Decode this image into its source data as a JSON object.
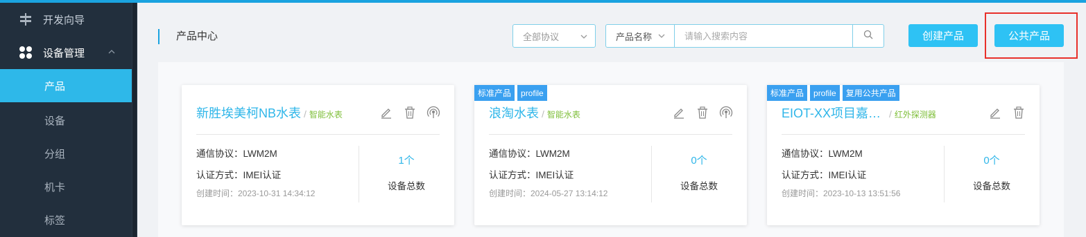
{
  "sidebar": {
    "items": [
      {
        "label": "开发向导",
        "icon": "signpost-icon"
      },
      {
        "label": "设备管理",
        "icon": "grid-icon"
      },
      {
        "label": "产品"
      },
      {
        "label": "设备"
      },
      {
        "label": "分组"
      },
      {
        "label": "机卡"
      },
      {
        "label": "标签"
      }
    ]
  },
  "header": {
    "title": "产品中心",
    "protocol_select": "全部协议",
    "search_type": "产品名称",
    "search_placeholder": "请输入搜索内容",
    "create_button": "创建产品",
    "public_button": "公共产品"
  },
  "cards": [
    {
      "tags": [],
      "name": "新胜埃美柯NB水表",
      "category": "智能水表",
      "protocol": "通信协议：LWM2M",
      "auth": "认证方式：IMEI认证",
      "created": "创建时间：2023-10-31 14:34:12",
      "count": "1个",
      "count_label": "设备总数"
    },
    {
      "tags": [
        "标准产品",
        "profile"
      ],
      "name": "浪淘水表",
      "category": "智能水表",
      "protocol": "通信协议：LWM2M",
      "auth": "认证方式：IMEI认证",
      "created": "创建时间：2024-05-27 13:14:12",
      "count": "0个",
      "count_label": "设备总数"
    },
    {
      "tags": [
        "标准产品",
        "profile",
        "复用公共产品"
      ],
      "name": "EIOT-XX项目嘉…",
      "category": "红外探测器",
      "protocol": "通信协议：LWM2M",
      "auth": "认证方式：IMEI认证",
      "created": "创建时间：2023-10-13 13:51:56",
      "count": "0个",
      "count_label": "设备总数"
    }
  ],
  "colors": {
    "accent": "#2ec2f4",
    "sidebar_bg": "#222f3d",
    "active_item": "#2eb8e9",
    "tag": "#3aa0f0",
    "category": "#7fbf3a",
    "highlight_box": "#e8302a"
  }
}
